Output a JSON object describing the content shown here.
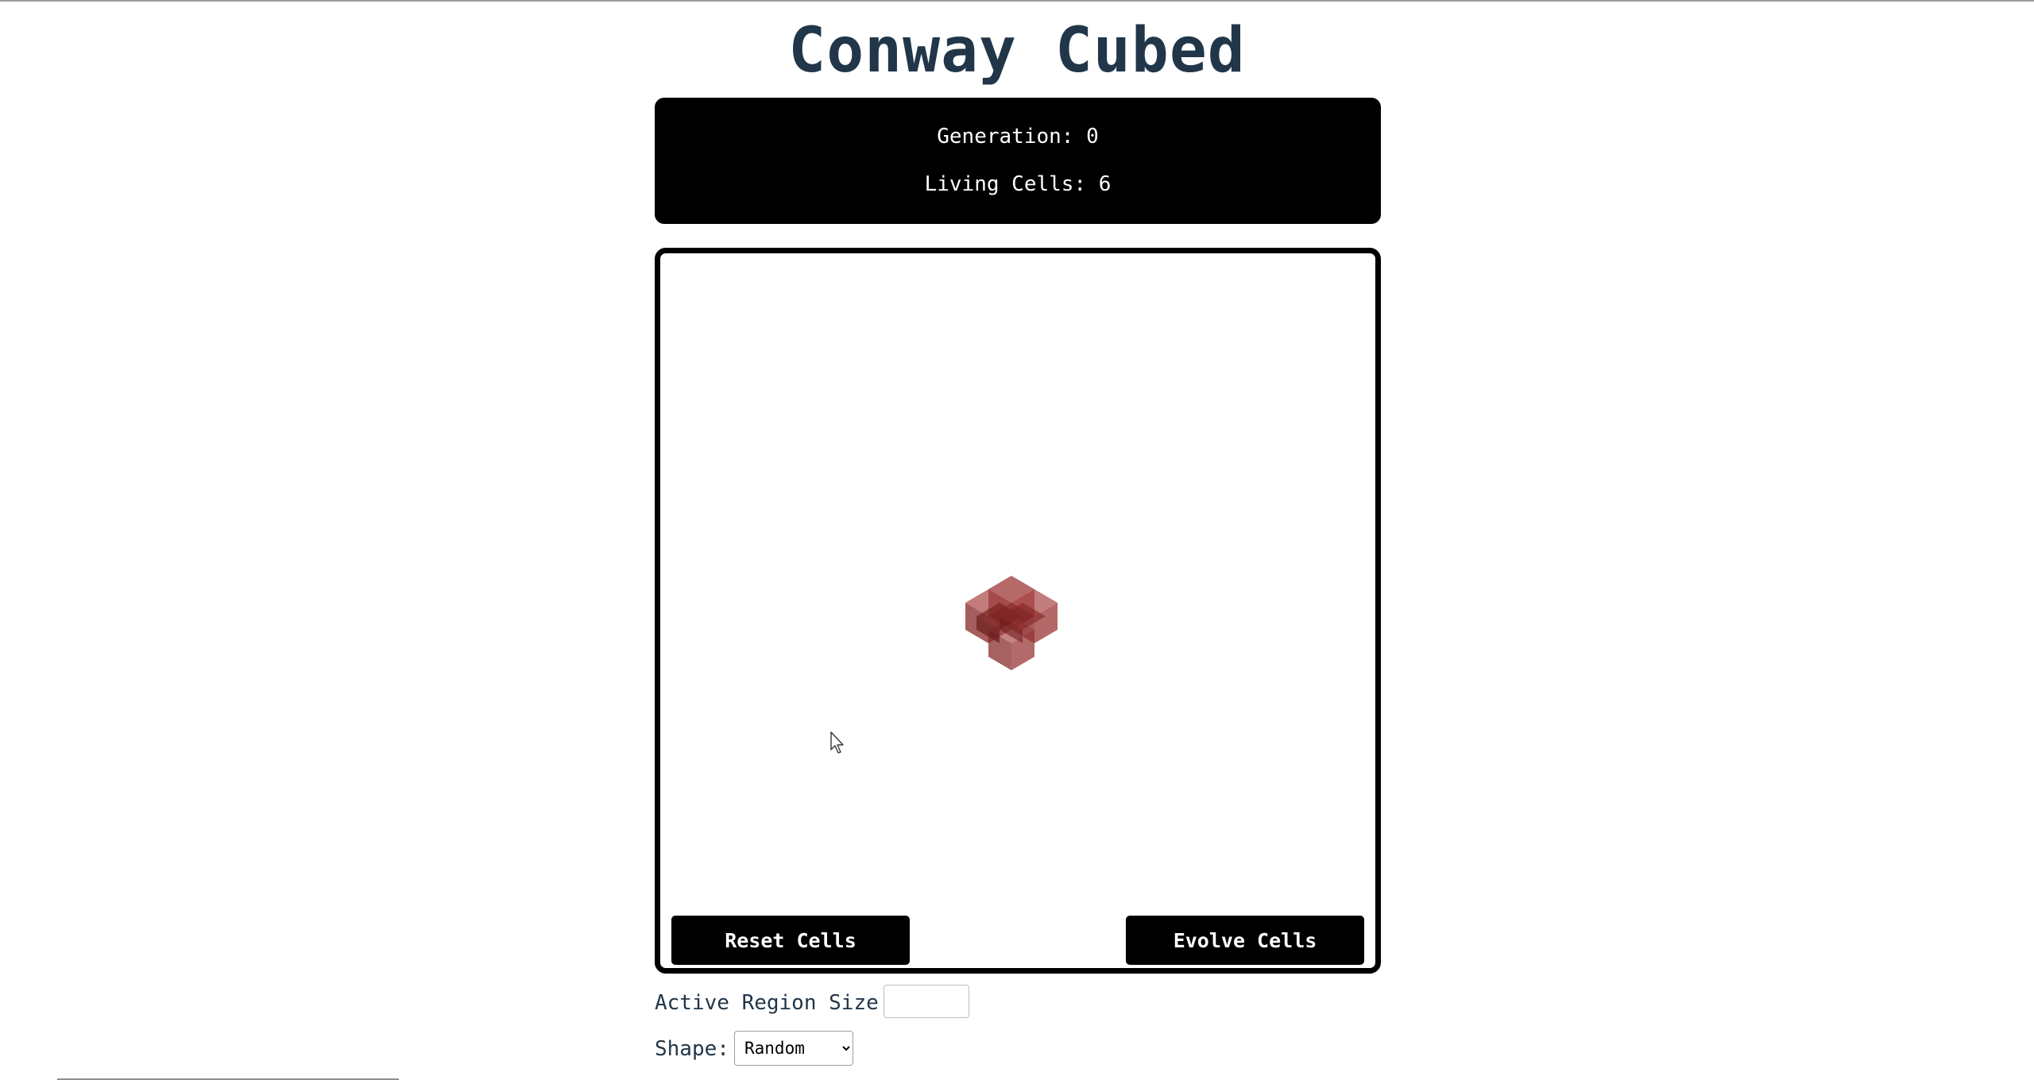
{
  "app": {
    "title": "Conway Cubed"
  },
  "stats": {
    "generation_label": "Generation: 0",
    "living_label": "Living Cells: 6"
  },
  "viewport": {
    "cell_color": "#8b1a1a",
    "live_cells": 6
  },
  "buttons": {
    "reset_label": "Reset Cells",
    "evolve_label": "Evolve Cells"
  },
  "controls": {
    "region_size_label": "Active Region Size:",
    "region_size_value": "",
    "shape_label": "Shape:",
    "shape_selected": "Random"
  },
  "colors": {
    "title": "#223649",
    "panel_bg": "#000000",
    "panel_text": "#ffffff",
    "cube": "#8b1a1a"
  },
  "icons": {
    "cursor": "arrow-cursor-icon",
    "select_arrow": "chevron-down-icon"
  }
}
